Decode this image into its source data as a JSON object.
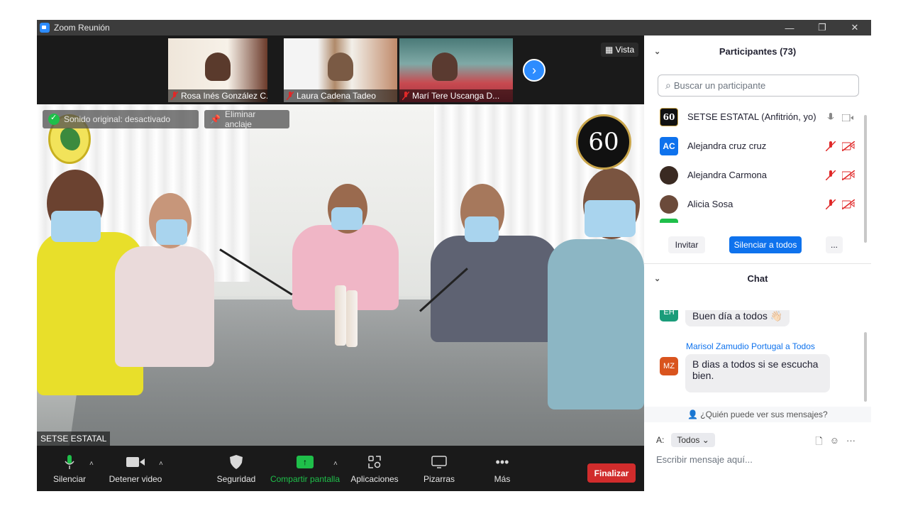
{
  "window": {
    "title": "Zoom Reunión",
    "controls": [
      "—",
      "❐",
      "✕"
    ]
  },
  "thumbnails": [
    {
      "name": "Rosa Inés González C..."
    },
    {
      "name": "Laura Cadena Tadeo"
    },
    {
      "name": "Marí Tere Uscanga D..."
    }
  ],
  "view_label": "Vista",
  "overlay": {
    "original_sound": "Sonido original: desactivado",
    "unpin": "Eliminar anclaje"
  },
  "logo_60_text": "60",
  "speaker_name": "SETSE ESTATAL",
  "toolbar": {
    "mute": "Silenciar",
    "stop_video": "Detener video",
    "security": "Seguridad",
    "share_screen": "Compartir pantalla",
    "apps": "Aplicaciones",
    "whiteboards": "Pizarras",
    "more": "Más",
    "end": "Finalizar"
  },
  "participants": {
    "header": "Participantes (73)",
    "search_placeholder": "Buscar un participante",
    "list": [
      {
        "name": "SETSE ESTATAL (Anfitrión, yo)",
        "avatar_text": "60",
        "avatar_color": "#111111"
      },
      {
        "name": "Alejandra  cruz cruz",
        "avatar_text": "AC",
        "avatar_color": "#0e72ed"
      },
      {
        "name": "Alejandra Carmona",
        "avatar_text": "",
        "avatar_color": "#3a2a22"
      },
      {
        "name": "Alicia Sosa",
        "avatar_text": "",
        "avatar_color": "#6b4a3a"
      }
    ],
    "invite": "Invitar",
    "mute_all": "Silenciar a todos",
    "more": "..."
  },
  "chat": {
    "header": "Chat",
    "messages": [
      {
        "avatar": "EH",
        "avatar_color": "#1a9c7a",
        "text": "Buen día a todos 👋🏻"
      },
      {
        "sender": "Marisol Zamudio Portugal a Todos",
        "avatar": "MZ",
        "avatar_color": "#d9541e",
        "text_line1": "B dias a todos si se escucha",
        "text_line2": "bien."
      }
    ],
    "who_can_see": "¿Quién puede ver sus mensajes?",
    "to_label": "A:",
    "to_value": "Todos",
    "input_placeholder": "Escribir mensaje aquí..."
  }
}
